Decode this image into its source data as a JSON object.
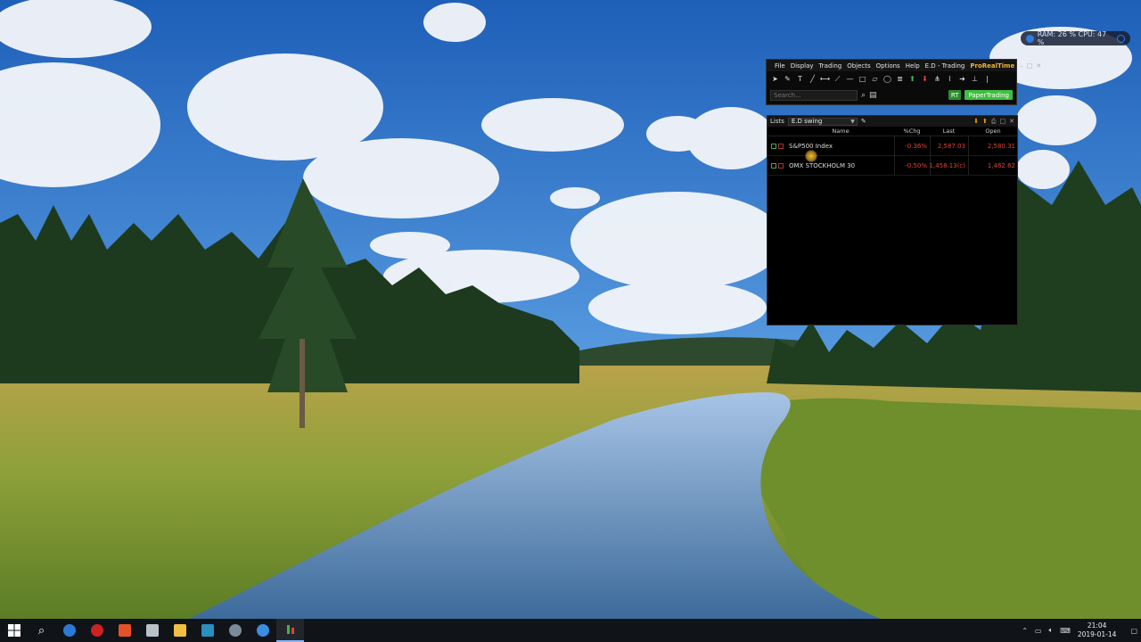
{
  "sysmon": {
    "text": "RAM: 26 %  CPU: 47 %"
  },
  "toolbar": {
    "menu": [
      "File",
      "Display",
      "Trading",
      "Objects",
      "Options",
      "Help",
      "E.D - Trading"
    ],
    "brand": "ProRealTime",
    "search_placeholder": "Search...",
    "rt_label": "RT",
    "papertrading_label": "PaperTrading"
  },
  "lists": {
    "title": "Lists",
    "selected_list": "E.D swing",
    "columns": [
      "Name",
      "%Chg",
      "Last",
      "Open"
    ],
    "rows": [
      {
        "name": "S&P500 Index",
        "chg": "-0.36%",
        "last": "2,587.03",
        "open": "2,580.31"
      },
      {
        "name": "OMX STOCKHOLM 30",
        "chg": "-0.50%",
        "last": "1,458.13(c)",
        "open": "1,462.62"
      }
    ]
  },
  "taskbar": {
    "time": "21:04",
    "date": "2019-01-14"
  },
  "colors": {
    "brand": "#f2b33a",
    "negative": "#e0433a",
    "papertrading": "#3fbf3f"
  }
}
